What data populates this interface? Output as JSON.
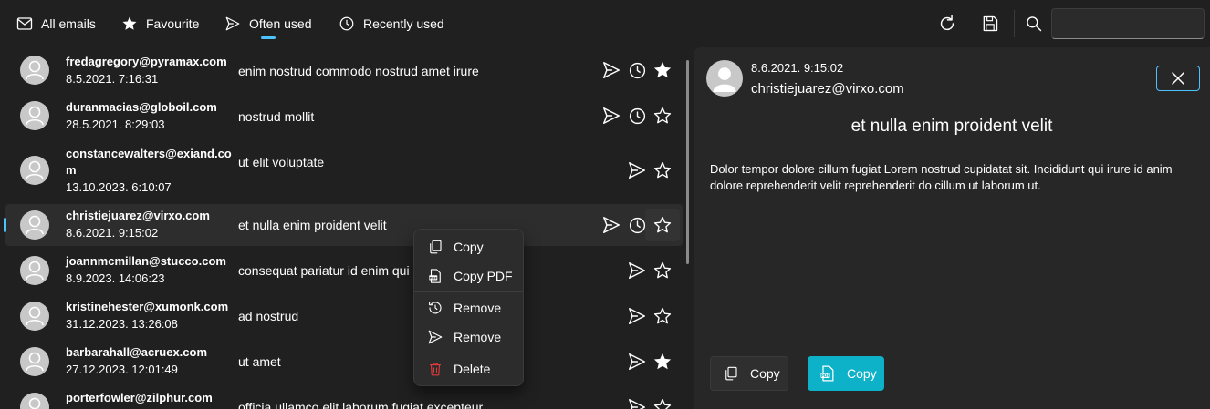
{
  "tabs": [
    {
      "label": "All emails",
      "icon": "mail-icon"
    },
    {
      "label": "Favourite",
      "icon": "star-filled-icon"
    },
    {
      "label": "Often used",
      "icon": "send-icon",
      "active": true
    },
    {
      "label": "Recently used",
      "icon": "clock-icon"
    }
  ],
  "toolbar": {
    "refresh_icon": "refresh-icon",
    "save_icon": "save-icon",
    "search_icon": "search-icon",
    "search_value": "",
    "search_placeholder": ""
  },
  "emails": [
    {
      "email": "fredagregory@pyramax.com",
      "date": "8.5.2021. 7:16:31",
      "subject": "enim nostrud commodo nostrud amet irure",
      "recent": true,
      "favourite": true
    },
    {
      "email": "duranmacias@globoil.com",
      "date": "28.5.2021. 8:29:03",
      "subject": "nostrud mollit",
      "recent": true,
      "favourite": false
    },
    {
      "email": "constancewalters@exiand.com",
      "date": "13.10.2023. 6:10:07",
      "subject": "ut elit voluptate",
      "recent": false,
      "favourite": false
    },
    {
      "email": "christiejuarez@virxo.com",
      "date": "8.6.2021. 9:15:02",
      "subject": "et nulla enim proident velit",
      "recent": true,
      "favourite": false,
      "selected": true
    },
    {
      "email": "joannmcmillan@stucco.com",
      "date": "8.9.2023. 14:06:23",
      "subject": "consequat pariatur id enim qui",
      "recent": false,
      "favourite": false
    },
    {
      "email": "kristinehester@xumonk.com",
      "date": "31.12.2023. 13:26:08",
      "subject": "ad nostrud",
      "recent": false,
      "favourite": false
    },
    {
      "email": "barbarahall@acruex.com",
      "date": "27.12.2023. 12:01:49",
      "subject": "ut amet",
      "recent": false,
      "favourite": true
    },
    {
      "email": "porterfowler@zilphur.com",
      "date": "",
      "subject": "officia ullamco elit laborum fugiat excepteur",
      "recent": false,
      "favourite": false
    }
  ],
  "context_menu": [
    {
      "label": "Copy",
      "icon": "copy-icon"
    },
    {
      "label": "Copy PDF",
      "icon": "pdf-icon"
    },
    {
      "label": "Remove",
      "icon": "history-icon"
    },
    {
      "label": "Remove",
      "icon": "send-icon"
    },
    {
      "label": "Delete",
      "icon": "trash-icon"
    }
  ],
  "detail": {
    "date": "8.6.2021. 9:15:02",
    "email": "christiejuarez@virxo.com",
    "subject": "et nulla enim proident velit",
    "body": "Dolor tempor dolore cillum fugiat Lorem nostrud cupidatat sit. Incididunt qui irure id anim dolore reprehenderit velit reprehenderit do cillum ut laborum ut.",
    "copy_label": "Copy",
    "copy_pdf_label": "Copy"
  },
  "colors": {
    "accent": "#4cc2ff",
    "pdf_button": "#0eb2c8",
    "delete_red": "#e03a3a",
    "background": "#202020",
    "pane": "#272727"
  }
}
